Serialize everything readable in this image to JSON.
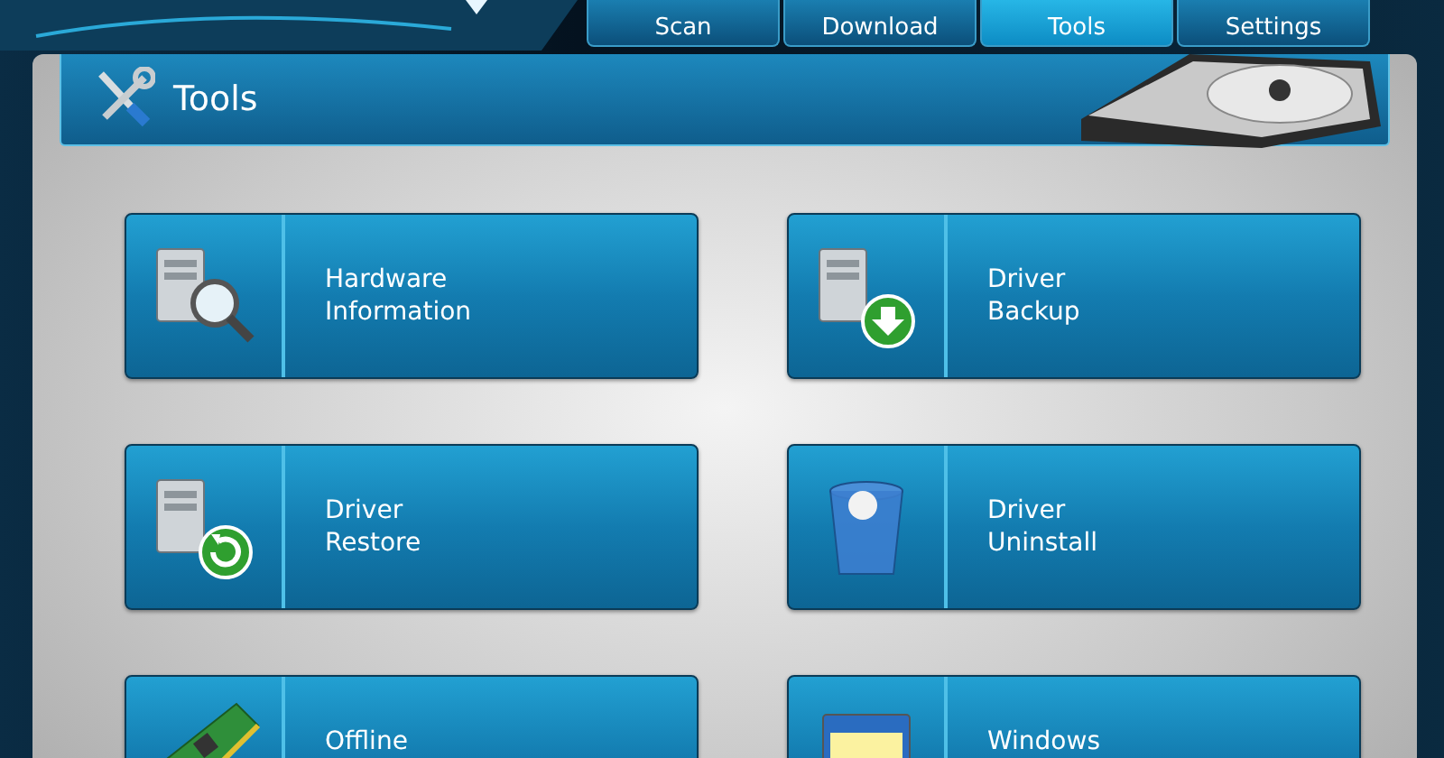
{
  "tabs": [
    {
      "label": "Scan",
      "selected": false
    },
    {
      "label": "Download",
      "selected": false
    },
    {
      "label": "Tools",
      "selected": true
    },
    {
      "label": "Settings",
      "selected": false
    }
  ],
  "panel": {
    "title": "Tools"
  },
  "tools": [
    {
      "kind": "hardware",
      "lines": [
        "Hardware",
        "Information"
      ]
    },
    {
      "kind": "backup",
      "lines": [
        "Driver",
        "Backup"
      ]
    },
    {
      "kind": "restore",
      "lines": [
        "Driver",
        "Restore"
      ]
    },
    {
      "kind": "uninstall",
      "lines": [
        "Driver",
        "Uninstall"
      ]
    },
    {
      "kind": "card",
      "lines": [
        "Offline"
      ]
    },
    {
      "kind": "window",
      "lines": [
        "Windows"
      ]
    }
  ]
}
